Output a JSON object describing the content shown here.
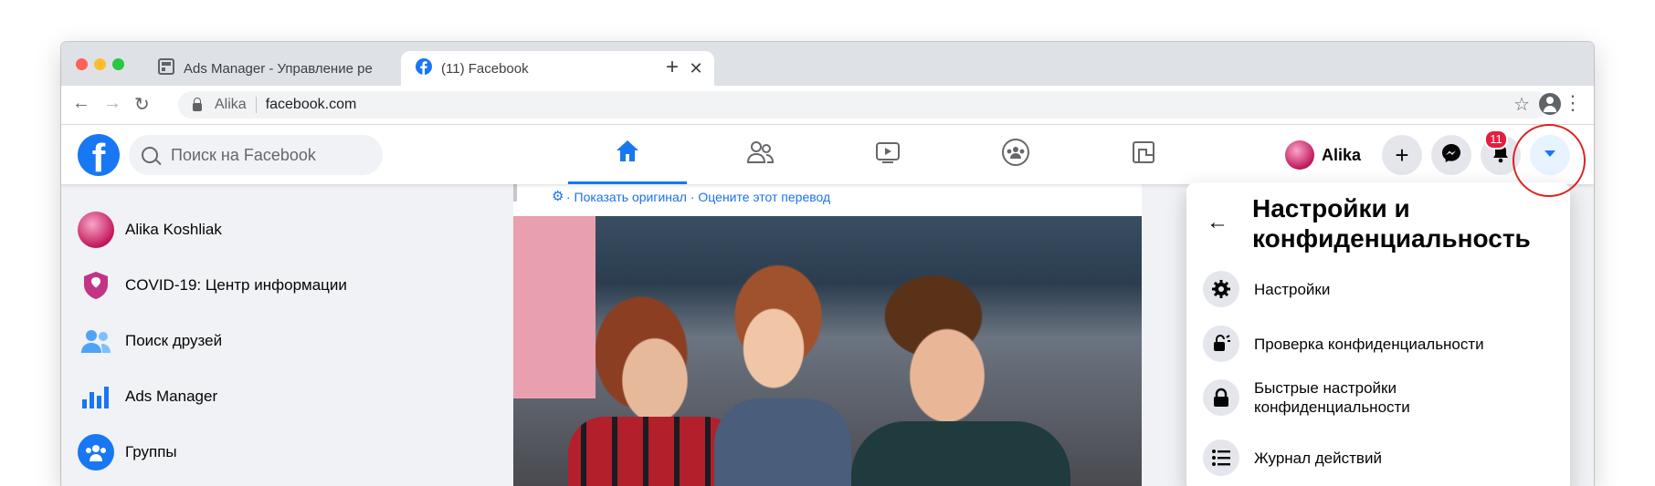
{
  "browser": {
    "tabs": [
      {
        "title": "Ads Manager - Управление ре",
        "active": false
      },
      {
        "title": "(11) Facebook",
        "active": true
      }
    ],
    "address": {
      "site_name": "Alika",
      "url": "facebook.com"
    }
  },
  "fb_header": {
    "logo": "f",
    "search_placeholder": "Поиск на Facebook",
    "nav_tabs": [
      "home-icon",
      "friends-icon",
      "watch-icon",
      "groups-icon",
      "gaming-icon"
    ],
    "active_tab": "home-icon",
    "user_name": "Alika",
    "notification_count": "11"
  },
  "sidebar": {
    "items": [
      {
        "label": "Alika Koshliak",
        "icon": "avatar"
      },
      {
        "label": "COVID-19: Центр информации",
        "icon": "covid-shield-icon"
      },
      {
        "label": "Поиск друзей",
        "icon": "friends-icon"
      },
      {
        "label": "Ads Manager",
        "icon": "ads-manager-icon"
      },
      {
        "label": "Группы",
        "icon": "groups-icon"
      }
    ]
  },
  "feed": {
    "translation_links": "· Показать оригинал · Оцените этот перевод"
  },
  "settings_menu": {
    "title": "Настройки и конфиденциальность",
    "items": [
      {
        "label": "Настройки",
        "icon": "gear-icon"
      },
      {
        "label": "Проверка конфиденциальности",
        "icon": "privacy-check-icon"
      },
      {
        "label": "Быстрые настройки конфиденциальности",
        "icon": "lock-icon"
      },
      {
        "label": "Журнал действий",
        "icon": "list-icon"
      }
    ]
  },
  "colors": {
    "brand": "#1877f2",
    "badge": "#e41e3f",
    "highlight_ring": "#e02020"
  }
}
